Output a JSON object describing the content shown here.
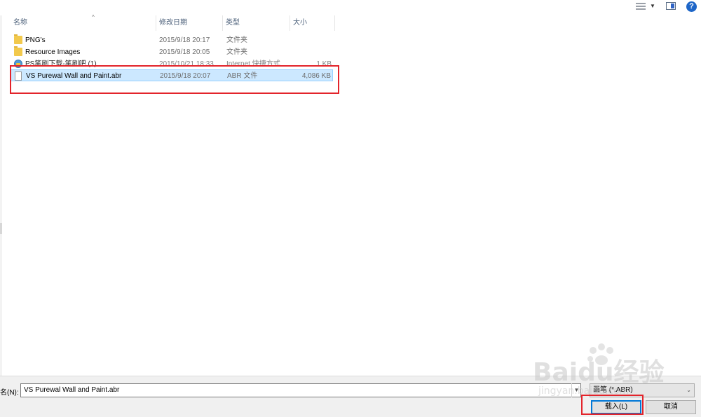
{
  "toolbar": {
    "view_icon": "details-view-icon",
    "view_dropdown": "chevron-down-icon",
    "pane_icon": "preview-pane-icon",
    "help_icon": "help-icon",
    "help_glyph": "?"
  },
  "columns": {
    "name": "名称",
    "date": "修改日期",
    "type": "类型",
    "size": "大小",
    "sort_glyph": "^"
  },
  "files": [
    {
      "name": "PNG's",
      "date": "2015/9/18 20:17",
      "type": "文件夹",
      "size": "",
      "icon": "folder-icon"
    },
    {
      "name": "Resource Images",
      "date": "2015/9/18 20:05",
      "type": "文件夹",
      "size": "",
      "icon": "folder-icon"
    },
    {
      "name": "PS笔刷下载-笔刷吧 (1)",
      "date": "2015/10/21 18:33",
      "type": "Internet 快捷方式",
      "size": "1 KB",
      "icon": "internet-shortcut-icon"
    },
    {
      "name": "VS Purewal Wall and Paint.abr",
      "date": "2015/9/18 20:07",
      "type": "ABR 文件",
      "size": "4,086 KB",
      "icon": "file-icon",
      "selected": true
    }
  ],
  "bottom": {
    "filename_label": "名(N):",
    "filename_value": "VS Purewal Wall and Paint.abr",
    "filetype_value": "画笔 (*.ABR)",
    "load_button": "载入(L)",
    "cancel_button": "取消"
  },
  "watermark": {
    "brand": "Baidu经验",
    "url": "jingyan.baidu.com"
  },
  "colors": {
    "selection": "#cce8ff",
    "highlight": "#e3242b",
    "accent": "#0078d7"
  }
}
